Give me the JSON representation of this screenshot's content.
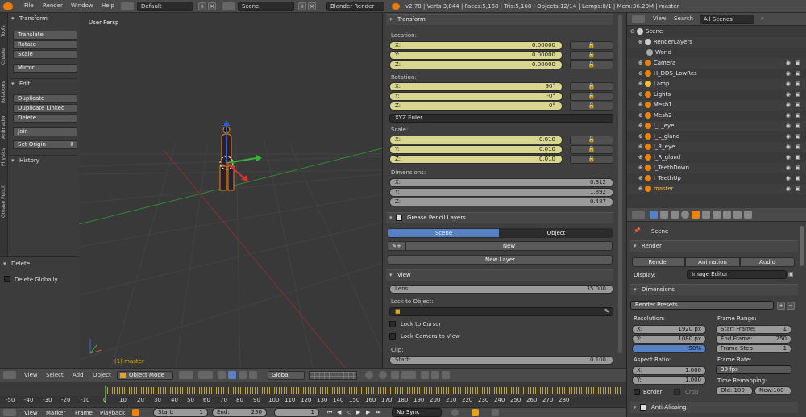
{
  "topbar": {
    "menus": [
      "File",
      "Render",
      "Window",
      "Help"
    ],
    "layout": "Default",
    "scene": "Scene",
    "engine": "Blender Render",
    "stats": "v2.78 | Verts:3,844 | Faces:5,168 | Tris:5,168 | Objects:12/14 | Lamps:0/1 | Mem:36.20M | master"
  },
  "left_tabs": [
    "Tools",
    "Create",
    "Relations",
    "Animation",
    "Physics",
    "Grease Pencil"
  ],
  "tools": {
    "transform_hdr": "Transform",
    "translate": "Translate",
    "rotate": "Rotate",
    "scale": "Scale",
    "mirror": "Mirror",
    "edit_hdr": "Edit",
    "duplicate": "Duplicate",
    "duplicate_linked": "Duplicate Linked",
    "delete": "Delete",
    "join": "Join",
    "set_origin": "Set Origin",
    "history_hdr": "History"
  },
  "operator": {
    "hdr": "Delete",
    "delete_globally": "Delete Globally"
  },
  "viewport": {
    "view_label": "User Persp",
    "object_label": "(1) master"
  },
  "properties": {
    "transform_hdr": "Transform",
    "location_lbl": "Location:",
    "loc_x": "X:",
    "loc_x_v": "0.00000",
    "loc_y": "Y:",
    "loc_y_v": "0.00000",
    "loc_z": "Z:",
    "loc_z_v": "0.00000",
    "rotation_lbl": "Rotation:",
    "rot_x": "X:",
    "rot_x_v": "90°",
    "rot_y": "Y:",
    "rot_y_v": "-0°",
    "rot_z": "Z:",
    "rot_z_v": "0°",
    "euler": "XYZ Euler",
    "scale_lbl": "Scale:",
    "sc_x": "X:",
    "sc_x_v": "0.010",
    "sc_y": "Y:",
    "sc_y_v": "0.010",
    "sc_z": "Z:",
    "sc_z_v": "0.010",
    "dim_lbl": "Dimensions:",
    "dim_x": "X:",
    "dim_x_v": "0.812",
    "dim_y": "Y:",
    "dim_y_v": "1.892",
    "dim_z": "Z:",
    "dim_z_v": "0.487",
    "gp_hdr": "Grease Pencil Layers",
    "gp_scene": "Scene",
    "gp_object": "Object",
    "gp_new": "New",
    "gp_new_layer": "New Layer",
    "view_hdr": "View",
    "lens_lbl": "Lens:",
    "lens_v": "35.000",
    "lock_obj": "Lock to Object:",
    "lock_cursor": "Lock to Cursor",
    "lock_camera": "Lock Camera to View",
    "clip_lbl": "Clip:",
    "clip_start": "Start:",
    "clip_start_v": "0.100"
  },
  "outliner": {
    "view": "View",
    "search": "Search",
    "filter": "All Scenes",
    "rows": [
      "Scene",
      "RenderLayers",
      "World",
      "Camera",
      "H_DDS_LowRes",
      "Lamp",
      "Lights",
      "Mesh1",
      "Mesh2",
      "l_L_eye",
      "l_L_gland",
      "l_R_eye",
      "l_R_gland",
      "l_TeethDown",
      "l_TeethUp",
      "master"
    ]
  },
  "render": {
    "scene": "Scene",
    "render_hdr": "Render",
    "render_btn": "Render",
    "animation_btn": "Animation",
    "audio_btn": "Audio",
    "display_lbl": "Display:",
    "display_v": "Image Editor",
    "dimensions_hdr": "Dimensions",
    "presets": "Render Presets",
    "resolution_lbl": "Resolution:",
    "res_x": "X:",
    "res_x_v": "1920 px",
    "res_y": "Y:",
    "res_y_v": "1080 px",
    "res_pct": "50%",
    "frame_range_lbl": "Frame Range:",
    "start_frame": "Start Frame:",
    "start_frame_v": "1",
    "end_frame": "End Frame:",
    "end_frame_v": "250",
    "frame_step": "Frame Step:",
    "frame_step_v": "1",
    "aspect_lbl": "Aspect Ratio:",
    "asp_x": "X:",
    "asp_x_v": "1.000",
    "asp_y": "Y:",
    "asp_y_v": "1.000",
    "frame_rate_lbl": "Frame Rate:",
    "fps": "30 fps",
    "remap_lbl": "Time Remapping:",
    "old": "Old: 100",
    "new": "New:100",
    "border": "Border",
    "crop": "Crop",
    "aa_hdr": "Anti-Aliasing"
  },
  "header3d": {
    "view": "View",
    "select": "Select",
    "add": "Add",
    "object": "Object",
    "mode": "Object Mode",
    "orientation": "Global"
  },
  "timeline": {
    "ticks": [
      "-50",
      "-40",
      "-30",
      "-20",
      "-10",
      "0",
      "10",
      "20",
      "30",
      "40",
      "50",
      "60",
      "70",
      "80",
      "90",
      "100",
      "110",
      "120",
      "130",
      "140",
      "150",
      "160",
      "170",
      "180",
      "190",
      "200",
      "210",
      "220",
      "230",
      "240",
      "250",
      "260",
      "270",
      "280"
    ],
    "view": "View",
    "marker": "Marker",
    "frame": "Frame",
    "playback": "Playback",
    "start": "Start:",
    "start_v": "1",
    "end": "End:",
    "end_v": "250",
    "current": "1",
    "sync": "No Sync"
  }
}
